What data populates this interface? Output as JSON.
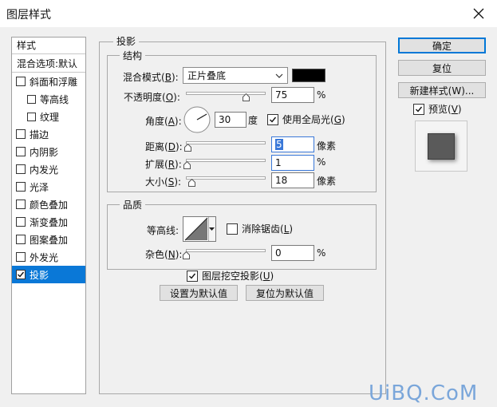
{
  "window": {
    "title": "图层样式"
  },
  "sidebar": {
    "header": "样式",
    "blend_options": "混合选项:默认",
    "items": [
      {
        "label": "斜面和浮雕",
        "checked": false,
        "indent": false
      },
      {
        "label": "等高线",
        "checked": false,
        "indent": true
      },
      {
        "label": "纹理",
        "checked": false,
        "indent": true
      },
      {
        "label": "描边",
        "checked": false,
        "indent": false
      },
      {
        "label": "内阴影",
        "checked": false,
        "indent": false
      },
      {
        "label": "内发光",
        "checked": false,
        "indent": false
      },
      {
        "label": "光泽",
        "checked": false,
        "indent": false
      },
      {
        "label": "颜色叠加",
        "checked": false,
        "indent": false
      },
      {
        "label": "渐变叠加",
        "checked": false,
        "indent": false
      },
      {
        "label": "图案叠加",
        "checked": false,
        "indent": false
      },
      {
        "label": "外发光",
        "checked": false,
        "indent": false
      },
      {
        "label": "投影",
        "checked": true,
        "indent": false,
        "selected": true
      }
    ]
  },
  "shadow": {
    "group_title": "投影",
    "structure": {
      "title": "结构",
      "blend_mode": {
        "label": "混合模式",
        "key": "B",
        "value": "正片叠底"
      },
      "shadow_color": "#000000",
      "opacity": {
        "label": "不透明度",
        "key": "O",
        "value": "75",
        "unit": "%",
        "fraction": 0.75
      },
      "angle": {
        "label": "角度",
        "key": "A",
        "value": "30",
        "unit": "度",
        "degrees": 30
      },
      "global_light": {
        "label": "使用全局光",
        "key": "G",
        "checked": true
      },
      "distance": {
        "label": "距离",
        "key": "D",
        "value": "5",
        "unit": "像素",
        "fraction": 0.02
      },
      "spread": {
        "label": "扩展",
        "key": "R",
        "value": "1",
        "unit": "%",
        "fraction": 0.01
      },
      "size": {
        "label": "大小",
        "key": "S",
        "value": "18",
        "unit": "像素",
        "fraction": 0.07
      }
    },
    "quality": {
      "title": "品质",
      "contour": {
        "label": "等高线"
      },
      "anti_alias": {
        "label": "消除锯齿",
        "key": "L",
        "checked": false
      },
      "noise": {
        "label": "杂色",
        "key": "N",
        "value": "0",
        "unit": "%",
        "fraction": 0.0
      }
    },
    "knockout": {
      "label": "图层挖空投影",
      "key": "U",
      "checked": true
    },
    "set_default": "设置为默认值",
    "reset_default": "复位为默认值"
  },
  "buttons": {
    "ok": "确定",
    "reset": "复位",
    "new_style": "新建样式(W)...",
    "preview": {
      "label": "预览",
      "key": "V",
      "checked": true
    }
  },
  "watermark": "UiBQ.CoM",
  "colors": {
    "selection": "#0a78d7",
    "focus": "#3a78d8"
  }
}
